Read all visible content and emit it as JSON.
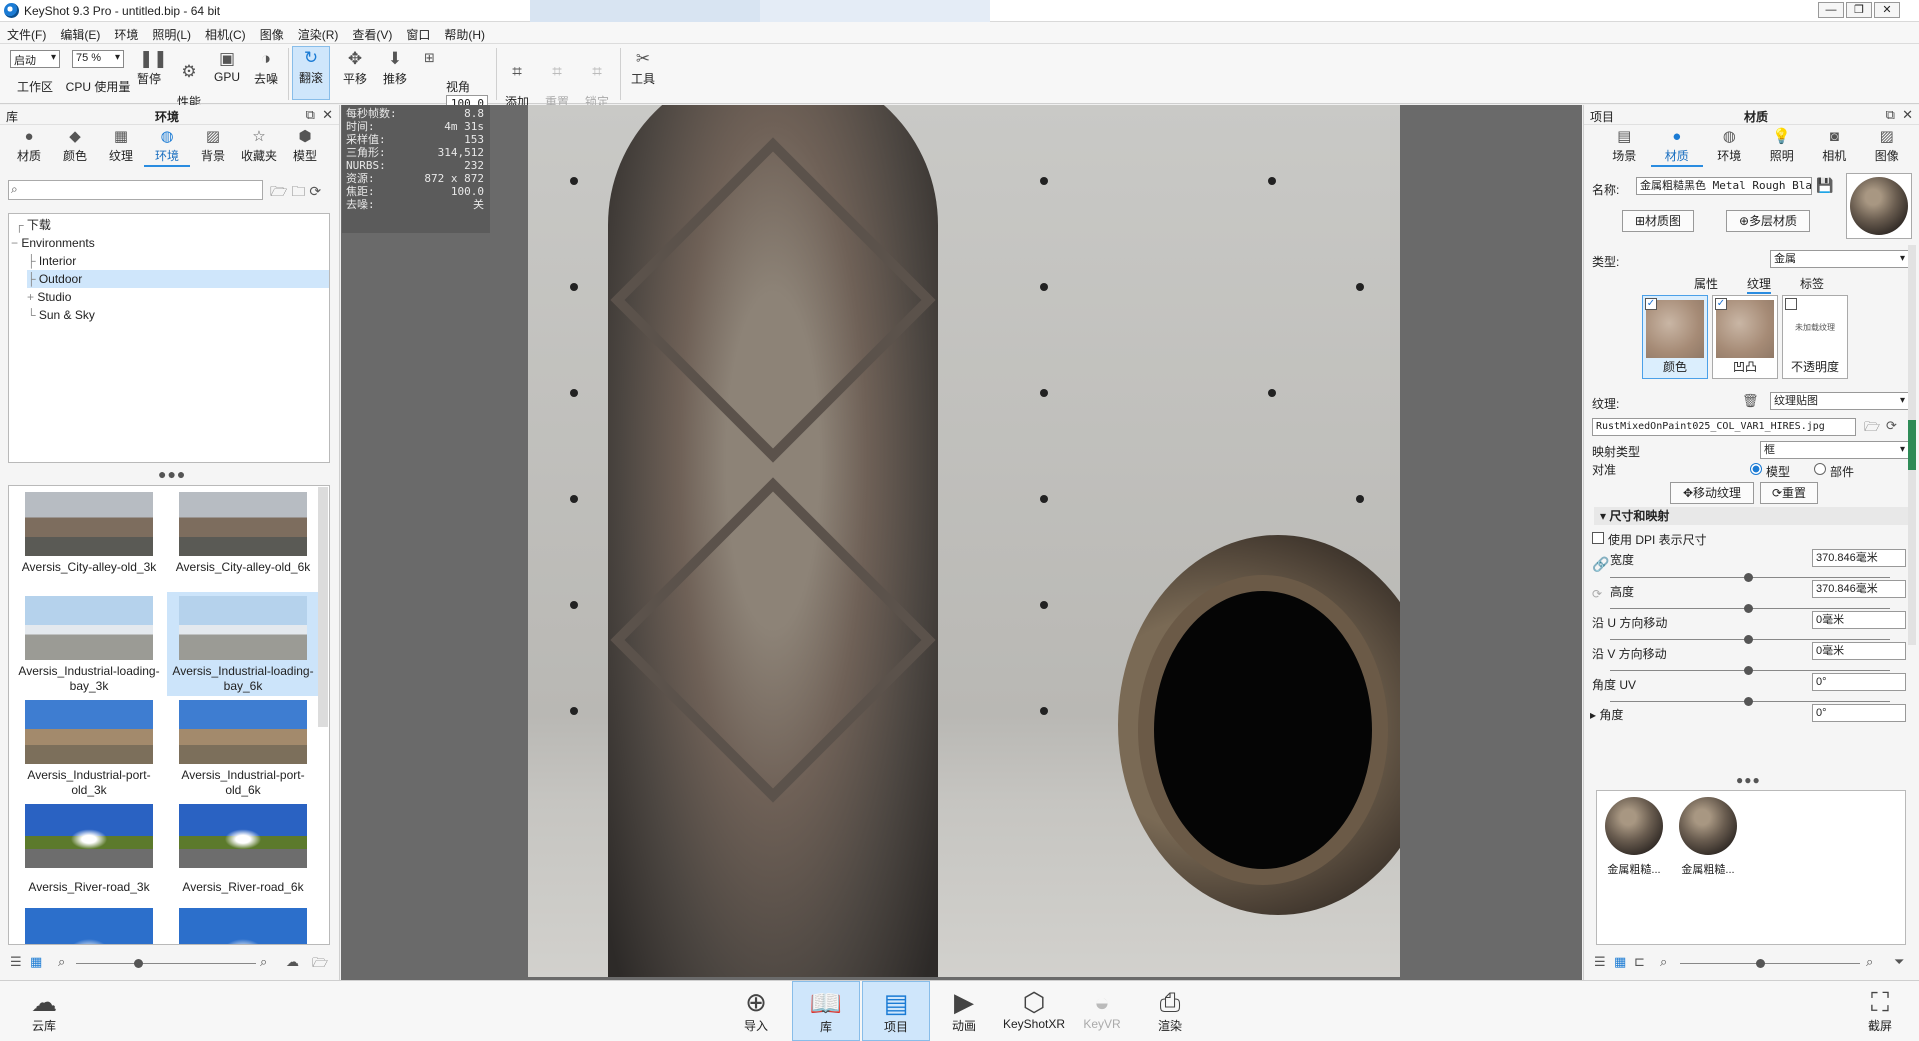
{
  "window": {
    "title": "KeyShot 9.3 Pro  - untitled.bip  - 64 bit",
    "controls": [
      "—",
      "❐",
      "✕"
    ]
  },
  "menu": [
    "文件(F)",
    "编辑(E)",
    "环境",
    "照明(L)",
    "相机(C)",
    "图像",
    "渲染(R)",
    "查看(V)",
    "窗口",
    "帮助(H)"
  ],
  "toolbar": {
    "workspace_value": "启动",
    "workspace_label": "工作区",
    "cpu_value": "75 %",
    "cpu_label": "CPU 使用量",
    "pause_label": "暂停",
    "perf_label": "性能\n模式",
    "gpu_label": "GPU",
    "denoise_label": "去噪",
    "tumble_label": "翻滚",
    "pan_label": "平移",
    "dolly_label": "推移",
    "fov_value": "100.0",
    "fov_label": "视角",
    "add_camera_label": "添加\n相机",
    "reset_camera_label": "重置\n相机",
    "lock_camera_label": "锁定\n相机",
    "tools_label": "工具"
  },
  "library": {
    "panel_label": "库",
    "panel_title": "环境",
    "tabs": [
      {
        "label": "材质",
        "icon": "material-icon"
      },
      {
        "label": "颜色",
        "icon": "color-icon"
      },
      {
        "label": "纹理",
        "icon": "texture-icon"
      },
      {
        "label": "环境",
        "icon": "environment-icon"
      },
      {
        "label": "背景",
        "icon": "background-icon"
      },
      {
        "label": "收藏夹",
        "icon": "favorites-icon"
      },
      {
        "label": "模型",
        "icon": "model-icon"
      }
    ],
    "search_placeholder": "",
    "tree": [
      "下载",
      "Environments",
      "Interior",
      "Outdoor",
      "Studio",
      "Sun & Sky"
    ],
    "thumbnails": [
      {
        "caption": "Aversis_City-alley-old_3k"
      },
      {
        "caption": "Aversis_City-alley-old_6k"
      },
      {
        "caption": "Aversis_Industrial-loading-bay_3k"
      },
      {
        "caption": "Aversis_Industrial-loading-bay_6k"
      },
      {
        "caption": "Aversis_Industrial-port-old_3k"
      },
      {
        "caption": "Aversis_Industrial-port-old_6k"
      },
      {
        "caption": "Aversis_River-road_3k"
      },
      {
        "caption": "Aversis_River-road_6k"
      }
    ]
  },
  "hud": [
    {
      "k": "每秒帧数:",
      "v": "8.8"
    },
    {
      "k": "时间:",
      "v": "4m 31s"
    },
    {
      "k": "采样值:",
      "v": "153"
    },
    {
      "k": "三角形:",
      "v": "314,512"
    },
    {
      "k": "NURBS:",
      "v": "232"
    },
    {
      "k": "资源:",
      "v": "872 x 872"
    },
    {
      "k": "焦距:",
      "v": "100.0"
    },
    {
      "k": "去噪:",
      "v": "关"
    }
  ],
  "project": {
    "panel_label": "项目",
    "panel_title": "材质",
    "tabs": [
      {
        "label": "场景",
        "icon": "scene-icon"
      },
      {
        "label": "材质",
        "icon": "material-icon"
      },
      {
        "label": "环境",
        "icon": "environment-icon"
      },
      {
        "label": "照明",
        "icon": "lighting-icon"
      },
      {
        "label": "相机",
        "icon": "camera-icon"
      },
      {
        "label": "图像",
        "icon": "image-icon"
      }
    ],
    "name_label": "名称:",
    "name_value": "金属粗糙黑色 Metal Rough Black",
    "material_graph_btn": "材质图",
    "multi_layer_btn": "多层材质",
    "type_label": "类型:",
    "type_value": "金属",
    "subtabs": [
      "属性",
      "纹理",
      "标签"
    ],
    "swatches": [
      {
        "label": "颜色",
        "checked": true
      },
      {
        "label": "凹凸",
        "checked": true
      },
      {
        "label": "不透明度",
        "checked": false,
        "placeholder": "未加载纹理"
      }
    ],
    "texture_label": "纹理:",
    "texture_type": "纹理贴图",
    "texture_file": "RustMixedOnPaint025_COL_VAR1_HIRES.jpg",
    "mapping_label": "映射类型",
    "mapping_value": "框",
    "align_label": "对准",
    "align_model": "模型",
    "align_part": "部件",
    "move_texture_btn": "移动纹理",
    "reset_btn": "重置",
    "section_size": "尺寸和映射",
    "dpi_label": "使用 DPI 表示尺寸",
    "width_label": "宽度",
    "width_value": "370.846毫米",
    "height_label": "高度",
    "height_value": "370.846毫米",
    "u_shift_label": "沿 U 方向移动",
    "u_shift_value": "0毫米",
    "v_shift_label": "沿 V 方向移动",
    "v_shift_value": "0毫米",
    "uv_angle_label": "角度 UV",
    "uv_angle_value": "0°",
    "angle_label": "角度",
    "angle_value": "0°",
    "materials": [
      {
        "label": "金属粗糙..."
      },
      {
        "label": "金属粗糙..."
      }
    ]
  },
  "bottombar": {
    "cloud_label": "云库",
    "import_label": "导入",
    "library_label": "库",
    "project_label": "项目",
    "animation_label": "动画",
    "keyshotxr_label": "KeyShotXR",
    "keyvr_label": "KeyVR",
    "render_label": "渲染",
    "screenshot_label": "截屏"
  }
}
